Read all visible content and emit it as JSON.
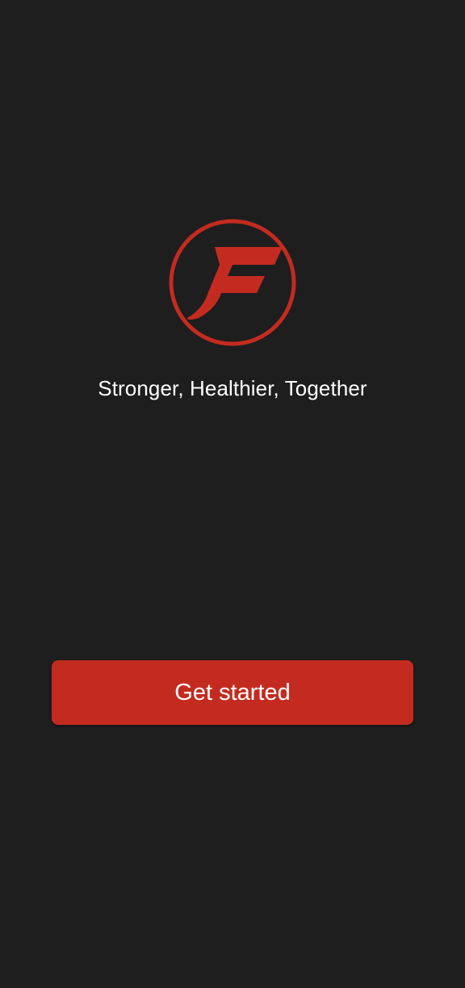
{
  "brand": {
    "logo_icon": "f-logo-icon",
    "accent_color": "#c42b20",
    "background_color": "#1e1e1e"
  },
  "tagline": "Stronger, Healthier, Together",
  "actions": {
    "get_started_label": "Get started"
  }
}
